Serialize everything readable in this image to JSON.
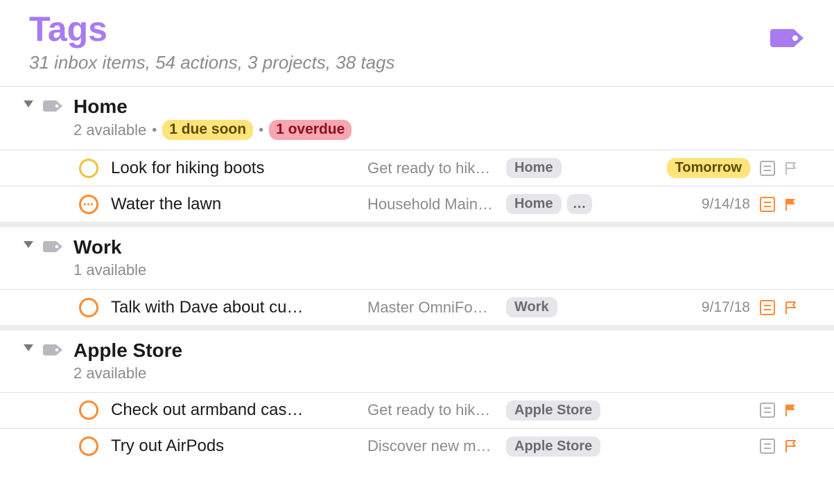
{
  "header": {
    "title": "Tags",
    "subtitle": "31 inbox items, 54 actions, 3 projects, 38 tags",
    "icon_color": "#a87bf0"
  },
  "groups": [
    {
      "id": "home",
      "name": "Home",
      "available_text": "2 available",
      "due_soon_text": "1 due soon",
      "overdue_text": "1 overdue",
      "items": [
        {
          "status": "yellow",
          "status_repeating": false,
          "title": "Look for hiking boots",
          "project": "Get ready to hik…",
          "tags": [
            "Home"
          ],
          "tags_overflow": false,
          "due_text": "Tomorrow",
          "due_pill": true,
          "has_note": true,
          "note_highlight": false,
          "flag_state": "outline"
        },
        {
          "status": "orange",
          "status_repeating": true,
          "title": "Water the lawn",
          "project": "Household Main…",
          "tags": [
            "Home"
          ],
          "tags_overflow": true,
          "overflow_label": "…",
          "due_text": "9/14/18",
          "due_pill": false,
          "has_note": true,
          "note_highlight": true,
          "flag_state": "solid"
        }
      ]
    },
    {
      "id": "work",
      "name": "Work",
      "available_text": "1 available",
      "due_soon_text": null,
      "overdue_text": null,
      "items": [
        {
          "status": "orange",
          "status_repeating": false,
          "title": "Talk with Dave about cu…",
          "project": "Master OmniFo…",
          "tags": [
            "Work"
          ],
          "tags_overflow": false,
          "due_text": "9/17/18",
          "due_pill": false,
          "has_note": true,
          "note_highlight": true,
          "flag_state": "outline-orange"
        }
      ]
    },
    {
      "id": "apple-store",
      "name": "Apple Store",
      "available_text": "2 available",
      "due_soon_text": null,
      "overdue_text": null,
      "items": [
        {
          "status": "orange",
          "status_repeating": false,
          "title": "Check out armband cas…",
          "project": "Get ready to hik…",
          "tags": [
            "Apple Store"
          ],
          "tags_overflow": false,
          "due_text": "",
          "due_pill": false,
          "has_note": true,
          "note_highlight": false,
          "flag_state": "solid"
        },
        {
          "status": "orange",
          "status_repeating": false,
          "title": "Try out AirPods",
          "project": "Discover new m…",
          "tags": [
            "Apple Store"
          ],
          "tags_overflow": false,
          "due_text": "",
          "due_pill": false,
          "has_note": true,
          "note_highlight": false,
          "flag_state": "outline-orange"
        }
      ]
    }
  ]
}
